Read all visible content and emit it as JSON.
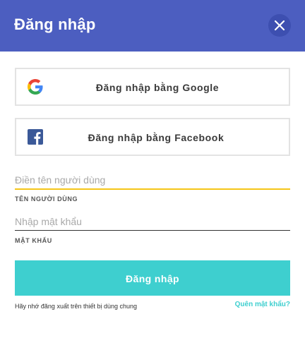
{
  "header": {
    "title": "Đăng nhập",
    "close_icon": "close-icon"
  },
  "social": {
    "google_label": "Đăng nhập bằng Google",
    "google_icon": "google-icon",
    "facebook_label": "Đăng nhập bằng Facebook",
    "facebook_icon": "facebook-icon"
  },
  "form": {
    "username_placeholder": "Điền tên người dùng",
    "username_value": "",
    "username_label": "TÊN NGƯỜI DÙNG",
    "password_placeholder": "Nhập mật khẩu",
    "password_value": "",
    "password_label": "MẬT KHẨU"
  },
  "actions": {
    "login_label": "Đăng nhập",
    "remember_text": "Hãy nhớ đăng xuất trên thiết bị dùng chung",
    "forgot_label": "Quên mật khẩu?"
  },
  "colors": {
    "header_bg": "#4c5ec0",
    "accent_teal": "#3ecfcf",
    "focus_underline": "#f5c518",
    "facebook_blue": "#3b5998"
  }
}
